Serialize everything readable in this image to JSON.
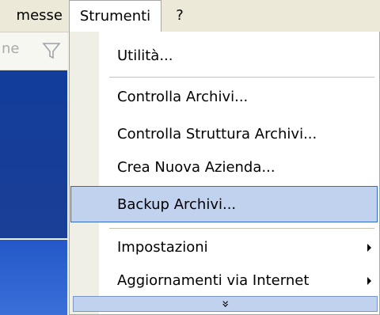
{
  "menubar": {
    "left_item": "messe",
    "strumenti": "Strumenti",
    "help": "?"
  },
  "left_toolbar": {
    "text": "ne",
    "funnel_icon": "funnel-icon"
  },
  "menu": {
    "items": [
      {
        "label": "Utilità...",
        "submenu": false
      },
      {
        "label": "Controlla Archivi...",
        "submenu": false
      },
      {
        "label": "Controlla Struttura Archivi...",
        "submenu": false
      },
      {
        "label": "Crea Nuova Azienda...",
        "submenu": false
      },
      {
        "label": "Backup Archivi...",
        "submenu": false,
        "highlighted": true
      },
      {
        "label": "Impostazioni",
        "submenu": true
      },
      {
        "label": "Aggiornamenti via Internet",
        "submenu": true
      }
    ],
    "expand_glyph": "»"
  },
  "colors": {
    "highlight": "#c1d2ee",
    "highlight_border": "#316ac5",
    "menubar": "#ece9d8",
    "left_blue": "#123d9b"
  }
}
